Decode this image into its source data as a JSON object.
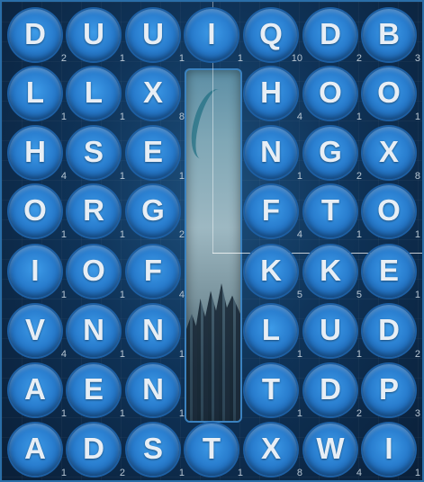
{
  "board": {
    "rows": [
      [
        {
          "letter": "D",
          "score": "2"
        },
        {
          "letter": "U",
          "score": "1"
        },
        {
          "letter": "U",
          "score": "1"
        },
        {
          "letter": "I",
          "score": "1"
        },
        {
          "letter": "Q",
          "score": "10"
        },
        {
          "letter": "D",
          "score": "2"
        },
        {
          "letter": "B",
          "score": "3"
        }
      ],
      [
        {
          "letter": "L",
          "score": "1"
        },
        {
          "letter": "L",
          "score": "1"
        },
        {
          "letter": "X",
          "score": "8"
        },
        null,
        {
          "letter": "H",
          "score": "4"
        },
        {
          "letter": "O",
          "score": "1"
        },
        {
          "letter": "O",
          "score": "1"
        }
      ],
      [
        {
          "letter": "H",
          "score": "4"
        },
        {
          "letter": "S",
          "score": "1"
        },
        {
          "letter": "E",
          "score": "1"
        },
        null,
        {
          "letter": "N",
          "score": "1"
        },
        {
          "letter": "G",
          "score": "2"
        },
        {
          "letter": "X",
          "score": "8"
        }
      ],
      [
        {
          "letter": "O",
          "score": "1"
        },
        {
          "letter": "R",
          "score": "1"
        },
        {
          "letter": "G",
          "score": "2"
        },
        null,
        {
          "letter": "F",
          "score": "4"
        },
        {
          "letter": "T",
          "score": "1"
        },
        {
          "letter": "O",
          "score": "1"
        }
      ],
      [
        {
          "letter": "I",
          "score": "1"
        },
        {
          "letter": "O",
          "score": "1"
        },
        {
          "letter": "F",
          "score": "4"
        },
        null,
        {
          "letter": "K",
          "score": "5"
        },
        {
          "letter": "K",
          "score": "5"
        },
        {
          "letter": "E",
          "score": "1"
        }
      ],
      [
        {
          "letter": "V",
          "score": "4"
        },
        {
          "letter": "N",
          "score": "1"
        },
        {
          "letter": "N",
          "score": "1"
        },
        null,
        {
          "letter": "L",
          "score": "1"
        },
        {
          "letter": "U",
          "score": "1"
        },
        {
          "letter": "D",
          "score": "2"
        }
      ],
      [
        {
          "letter": "A",
          "score": "1"
        },
        {
          "letter": "E",
          "score": "1"
        },
        {
          "letter": "N",
          "score": "1"
        },
        null,
        {
          "letter": "T",
          "score": "1"
        },
        {
          "letter": "D",
          "score": "2"
        },
        {
          "letter": "P",
          "score": "3"
        }
      ],
      [
        {
          "letter": "A",
          "score": "1"
        },
        {
          "letter": "D",
          "score": "2"
        },
        {
          "letter": "S",
          "score": "1"
        },
        {
          "letter": "T",
          "score": "1"
        },
        {
          "letter": "X",
          "score": "8"
        },
        {
          "letter": "W",
          "score": "4"
        },
        {
          "letter": "I",
          "score": "1"
        }
      ]
    ]
  },
  "center_panel": {
    "icon": "city-image"
  },
  "colors": {
    "tile": "#2a7fd0",
    "tile_ring": "#1d5fa3",
    "letter": "#e7eef5",
    "score": "#b7c6d3",
    "background": "#0f3358"
  }
}
